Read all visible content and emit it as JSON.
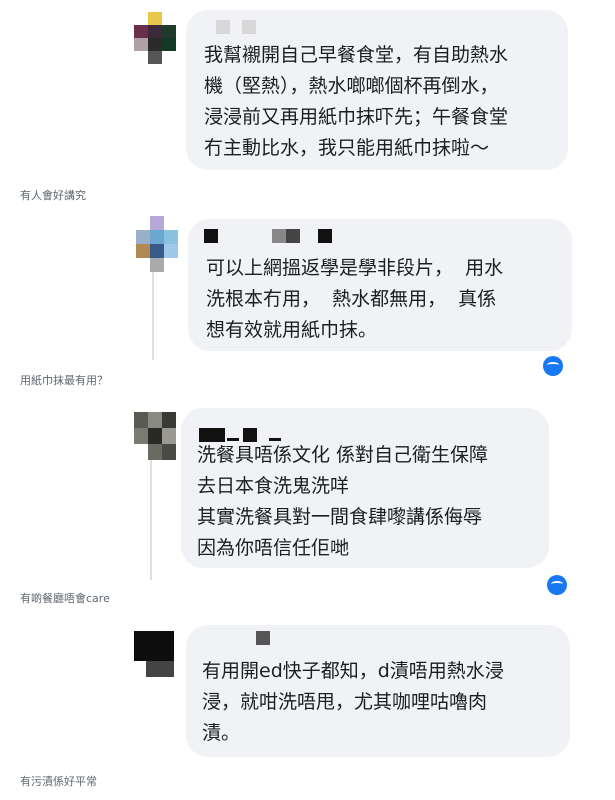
{
  "comments": [
    {
      "body": "我幫襯開自己早餐食堂，有自助熱水\n機（堅熱），熱水啷啷個杯再倒水，\n浸浸前又再用紙巾抹吓先；午餐食堂\n冇主動比水，我只能用紙巾抹啦～",
      "caption": "有人會好講究"
    },
    {
      "body": "可以上網搵返學是學非段片，  用水\n洗根本冇用，  熱水都無用，  真係\n想有效就用紙巾抹。",
      "caption": "用紙巾抹最有用？"
    },
    {
      "body": "洗餐具唔係文化 係對自己衛生保障\n去日本食洗鬼洗咩\n其實洗餐具對一間食肆嚟講係侮辱\n因為你唔信任佢哋",
      "caption": "有啲餐廳唔會care"
    },
    {
      "body": "有用開ed快子都知，d漬唔用熱水浸\n浸，就咁洗唔甩，尤其咖哩咕嚕肉\n漬。",
      "caption": "有污漬係好平常"
    }
  ],
  "colors": {
    "bubble": "#f0f2f5",
    "text": "#1c1e21",
    "caption": "#606770",
    "reaction": "#1877f2"
  },
  "icons": [
    "reaction-icon"
  ]
}
